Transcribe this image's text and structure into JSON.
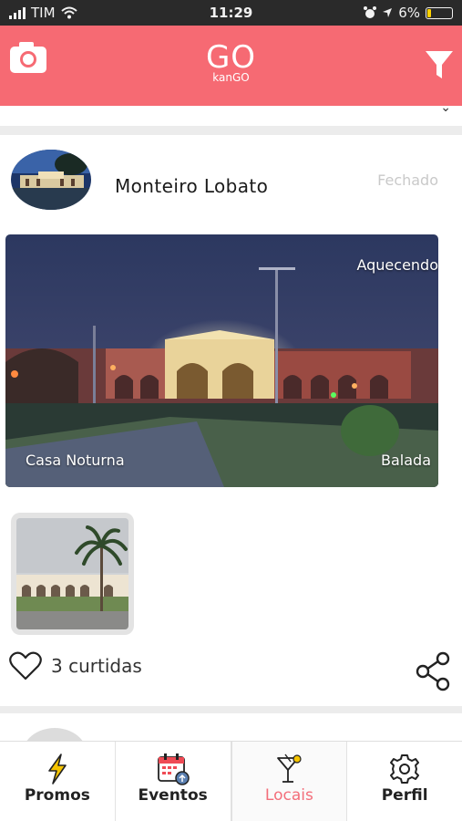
{
  "status_bar": {
    "carrier": "TIM",
    "time": "11:29",
    "battery": "6%"
  },
  "header": {
    "logo_main": "GO",
    "logo_sub": "kanGO",
    "accent": "#f66a73"
  },
  "card": {
    "name": "Monteiro Lobato",
    "status": "Fechado",
    "photo_tag_top": "Aquecendo",
    "photo_tag_left": "Casa Noturna",
    "photo_tag_right": "Balada",
    "likes": "3 curtidas"
  },
  "tabs": [
    {
      "label": "Promos",
      "icon": "lightning-icon"
    },
    {
      "label": "Eventos",
      "icon": "calendar-icon"
    },
    {
      "label": "Locais",
      "icon": "cocktail-icon",
      "active": true
    },
    {
      "label": "Perfil",
      "icon": "gear-icon"
    }
  ],
  "colors": {
    "active_tab": "#f36e7a",
    "closed_status": "#c9c9c9"
  }
}
